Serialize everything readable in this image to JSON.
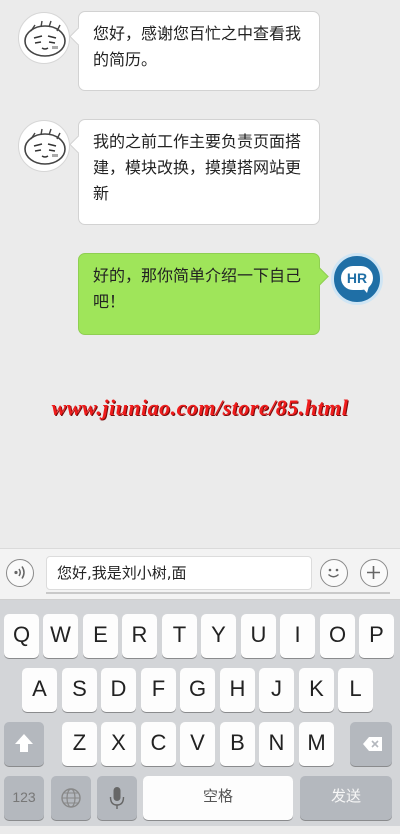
{
  "messages": [
    {
      "from": "candidate",
      "text": "您好，感谢您百忙之中查看我的简历。"
    },
    {
      "from": "candidate",
      "text": "我的之前工作主要负责页面搭建，模块改换，摸摸搭网站更新"
    },
    {
      "from": "hr",
      "text": "好的，那你简单介绍一下自己吧！"
    }
  ],
  "hr_avatar_label": "HR",
  "watermark": "www.jiuniao.com/store/85.html",
  "input": {
    "value": "您好,我是刘小树,面"
  },
  "keyboard": {
    "row1": [
      "Q",
      "W",
      "E",
      "R",
      "T",
      "Y",
      "U",
      "I",
      "O",
      "P"
    ],
    "row2": [
      "A",
      "S",
      "D",
      "F",
      "G",
      "H",
      "J",
      "K",
      "L"
    ],
    "row3": [
      "Z",
      "X",
      "C",
      "V",
      "B",
      "N",
      "M"
    ],
    "numbers_key": "123",
    "space_key": "空格",
    "send_key": "发送"
  },
  "icons": {
    "voice": "voice-icon",
    "emoji": "emoji-icon",
    "plus": "plus-icon",
    "shift": "shift-icon",
    "backspace": "backspace-icon",
    "globe": "globe-icon",
    "mic": "microphone-icon"
  },
  "colors": {
    "outgoing_bubble": "#9fe55a",
    "watermark": "#ef1c1c",
    "hr_avatar": "#1f6fa6"
  }
}
